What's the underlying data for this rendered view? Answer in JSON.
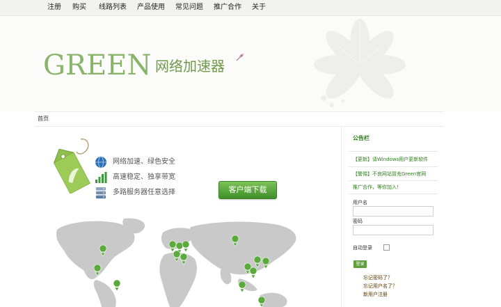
{
  "nav": {
    "items": [
      "注册",
      "购买",
      "线路列表",
      "产品使用",
      "常见问题",
      "推广合作",
      "关于"
    ]
  },
  "header": {
    "logo_word": "GREEN",
    "logo_cn": "网络加速器"
  },
  "breadcrumb": {
    "home": "首页"
  },
  "main": {
    "features": [
      "网络加速、绿色安全",
      "高速稳定、独享带宽",
      "多路服务器任意选择"
    ],
    "download_label": "客户端下载"
  },
  "sidebar": {
    "title": "公告栏",
    "news": [
      "【更新】请Windows用户更新软件",
      "【警惕】不良网站冒充Green官网"
    ],
    "promo": "推广合作，等你加入！",
    "username_label": "用户名",
    "password_label": "密码",
    "autologin_label": "自动登录",
    "login_label": "登录",
    "links": [
      "忘记密码了？",
      "忘记用户名了？",
      "新用户注册"
    ]
  },
  "colors": {
    "brand_green": "#8ab46a",
    "link_green": "#2e7d1b",
    "button_green": "#4fa233"
  }
}
